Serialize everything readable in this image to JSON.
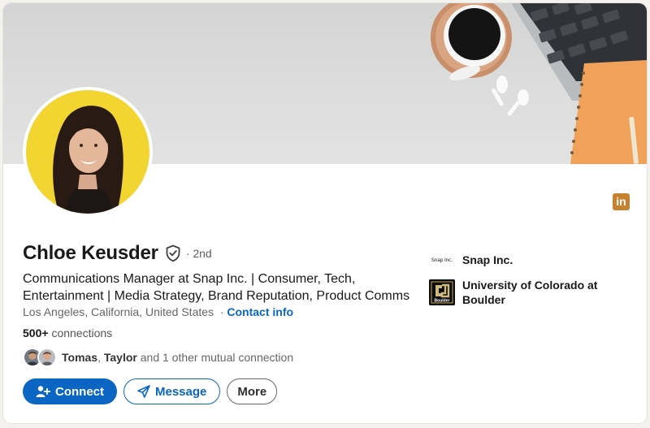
{
  "profile": {
    "name": "Chloe Keusder",
    "degree": "· 2nd",
    "headline": "Communications Manager at Snap Inc. | Consumer, Tech, Entertainment | Media Strategy, Brand Reputation, Product Comms",
    "location": "Los Angeles, California, United States",
    "location_sep": "·",
    "contact_info": "Contact info",
    "connections_count": "500+",
    "connections_label": "connections",
    "mutual": {
      "names_a": "Tomas",
      "sep": ", ",
      "names_b": "Taylor",
      "rest": " and 1 other mutual connection"
    }
  },
  "actions": {
    "connect": "Connect",
    "message": "Message",
    "more": "More"
  },
  "orgs": {
    "company": {
      "name": "Snap Inc.",
      "logo_text": "Snap Inc."
    },
    "school": {
      "name": "University of Colorado at Boulder",
      "logo_text": "Boulder"
    }
  },
  "badge": {
    "text": "in",
    "color": "#c6822f"
  },
  "colors": {
    "accent": "#0a66c2",
    "avatar_bg": "#f2d530",
    "notebook": "#f0a15a"
  },
  "icons": {
    "verified": "shield-check-icon",
    "connect": "add-person-icon",
    "message": "send-icon",
    "badge": "linkedin-icon"
  }
}
